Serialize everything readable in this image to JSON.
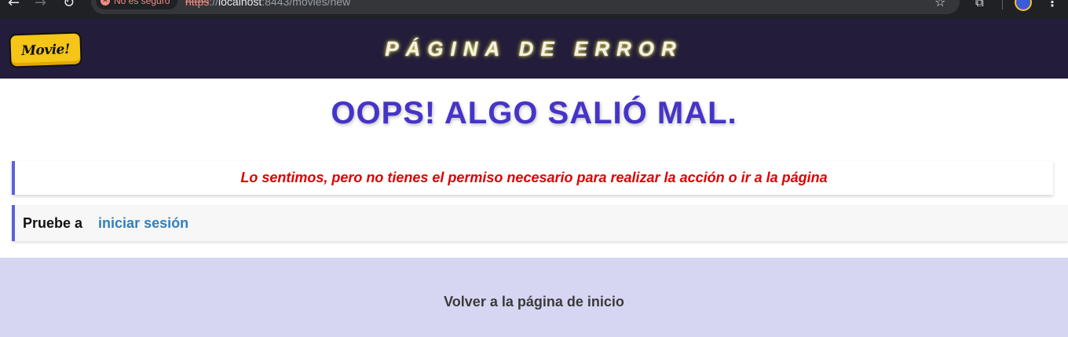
{
  "browser": {
    "security_label": "No es seguro",
    "url_scheme": "https",
    "url_sep": "://",
    "url_host": "localhost",
    "url_rest": ":8443/movies/new"
  },
  "header": {
    "logo_text": "Movie!",
    "title": "PÁGINA DE ERROR"
  },
  "main": {
    "heading": "OOPS! ALGO SALIÓ MAL.",
    "message": "Lo sentimos, pero no tienes el permiso necesario para realizar la acción o ir a la página",
    "suggest_label": "Pruebe a",
    "suggest_link": "iniciar sesión"
  },
  "footer": {
    "home_link": "Volver a la página de inicio"
  },
  "colors": {
    "header_bg": "#231c3a",
    "heading": "#4634c8",
    "error_text": "#e00000",
    "link": "#2f7fc1",
    "footer_bg": "#d6d6f3",
    "accent_border": "#5a63d8"
  },
  "icons": [
    "back-arrow-icon",
    "forward-arrow-icon",
    "reload-icon",
    "insecure-icon",
    "bookmark-star-icon",
    "extensions-icon",
    "profile-avatar",
    "more-menu-icon"
  ]
}
